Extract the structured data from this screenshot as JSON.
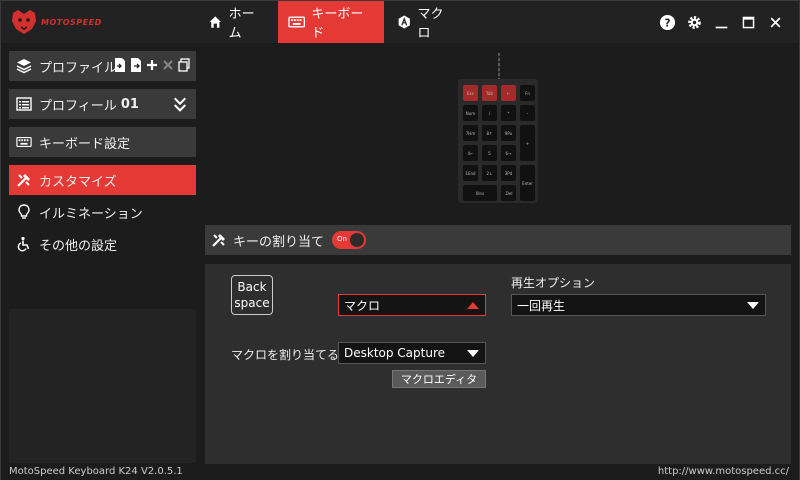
{
  "app": {
    "logo_text": "MOTOSPEED",
    "brand_color": "#e53935"
  },
  "nav": {
    "tabs": [
      {
        "label": "ホーム",
        "icon": "home-icon",
        "active": false
      },
      {
        "label": "キーボード",
        "icon": "keyboard-icon",
        "active": true
      },
      {
        "label": "マクロ",
        "icon": "macro-icon",
        "active": false
      }
    ],
    "controls": [
      "help-icon",
      "gear-icon",
      "minimize-icon",
      "maximize-icon",
      "close-icon"
    ]
  },
  "sidebar": {
    "profile_header": "プロファイル",
    "profile_selected_prefix": "プロフィール ",
    "profile_selected_num": "01",
    "keyboard_settings": "キーボード設定",
    "items": [
      {
        "label": "カスタマイズ",
        "icon": "customize-icon",
        "active": true
      },
      {
        "label": "イルミネーション",
        "icon": "lightbulb-icon",
        "active": false
      },
      {
        "label": "その他の設定",
        "icon": "accessibility-icon",
        "active": false
      }
    ]
  },
  "numpad": {
    "keys": [
      {
        "label": "Esc",
        "red": true
      },
      {
        "label": "Tab",
        "red": true
      },
      {
        "label": "←",
        "red": true
      },
      {
        "label": "Fn",
        "red": false
      },
      {
        "label": "Num",
        "red": false
      },
      {
        "label": "/",
        "red": false
      },
      {
        "label": "*",
        "red": false
      },
      {
        "label": "-",
        "red": false
      },
      {
        "label": "7Hm",
        "red": false
      },
      {
        "label": "8↑",
        "red": false
      },
      {
        "label": "9Pu",
        "red": false
      },
      {
        "label": "+",
        "red": false
      },
      {
        "label": "4←",
        "red": false
      },
      {
        "label": "5",
        "red": false
      },
      {
        "label": "6→",
        "red": false
      },
      {
        "label": "1End",
        "red": false
      },
      {
        "label": "2↓",
        "red": false
      },
      {
        "label": "3Pd",
        "red": false
      },
      {
        "label": "Enter",
        "red": false
      },
      {
        "label": "0Ins",
        "red": false
      },
      {
        "label": ".Del",
        "red": false
      }
    ]
  },
  "assign": {
    "title": "キーの割り当て",
    "toggle_label": "On",
    "toggle_on": true
  },
  "panel": {
    "key_label_line1": "Back",
    "key_label_line2": "space",
    "function_select": "マクロ",
    "playback_label": "再生オプション",
    "playback_select": "一回再生",
    "macro_assign_label": "マクロを割り当てる",
    "macro_select": "Desktop Capture",
    "macro_editor_button": "マクロエディタ"
  },
  "status": {
    "version": "MotoSpeed Keyboard K24 V2.0.5.1",
    "url": "http://www.motospeed.cc/"
  }
}
